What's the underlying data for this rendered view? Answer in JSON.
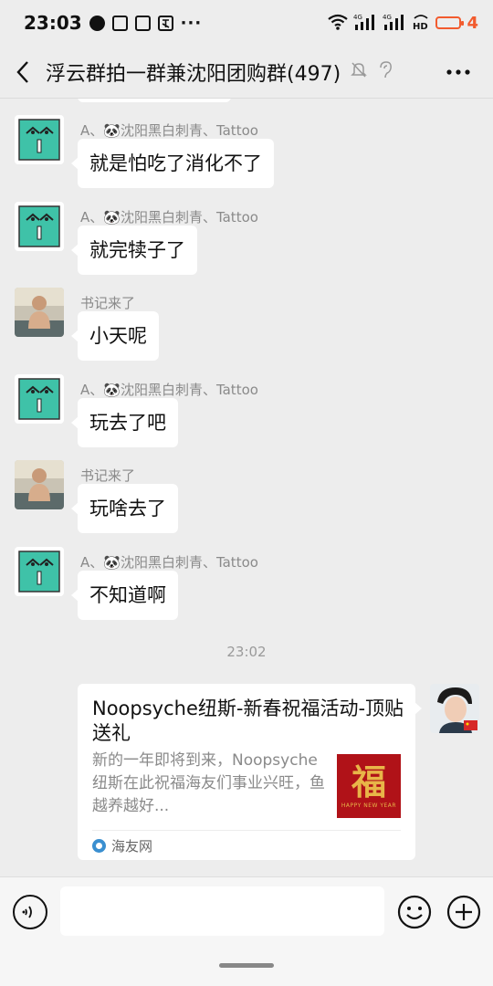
{
  "status_bar": {
    "time": "23:03",
    "more": "···",
    "net_1": "4G",
    "net_2": "4G",
    "hd": "HD",
    "battery": "4"
  },
  "header": {
    "title": "浮云群拍一群兼沈阳团购群(497)"
  },
  "messages": [
    {
      "sender": "A、🐼沈阳黑白刺青、Tattoo",
      "text": "就是怕吃了消化不了",
      "avatar": "green-face"
    },
    {
      "sender": "A、🐼沈阳黑白刺青、Tattoo",
      "text": "就完犊子了",
      "avatar": "green-face"
    },
    {
      "sender": "书记来了",
      "text": "小天呢",
      "avatar": "child-photo"
    },
    {
      "sender": "A、🐼沈阳黑白刺青、Tattoo",
      "text": "玩去了吧",
      "avatar": "green-face"
    },
    {
      "sender": "书记来了",
      "text": "玩啥去了",
      "avatar": "child-photo"
    },
    {
      "sender": "A、🐼沈阳黑白刺青、Tattoo",
      "text": "不知道啊",
      "avatar": "green-face"
    }
  ],
  "timestamp": "23:02",
  "link_card": {
    "title": "Noopsyche纽斯-新春祝福活动-顶贴送礼",
    "description": "新的一年即将到来，Noopsyche纽斯在此祝福海友们事业兴旺，鱼越养越好...",
    "thumbnail_char": "福",
    "thumbnail_sub": "HAPPY NEW YEAR",
    "source": "海友网"
  },
  "colors": {
    "background": "#ededed",
    "bubble": "#ffffff",
    "battery": "#f25b2e",
    "green_avatar": "#3fc2a8",
    "thumb_red": "#b01218"
  }
}
